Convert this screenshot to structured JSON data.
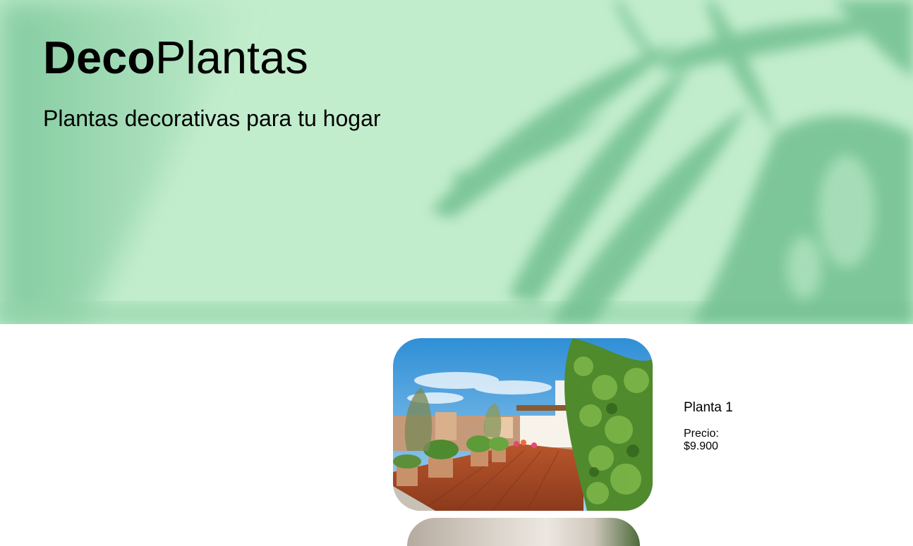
{
  "header": {
    "brand_bold": "Deco",
    "brand_regular": "Plantas",
    "tagline": "Plantas decorativas para tu hogar"
  },
  "products": [
    {
      "name": "Planta 1",
      "price_label": "Precio:",
      "price_value": "$9.900"
    }
  ],
  "colors": {
    "hero_background": "#c2edcd",
    "leaf_shadow": "#6bbc8e"
  }
}
